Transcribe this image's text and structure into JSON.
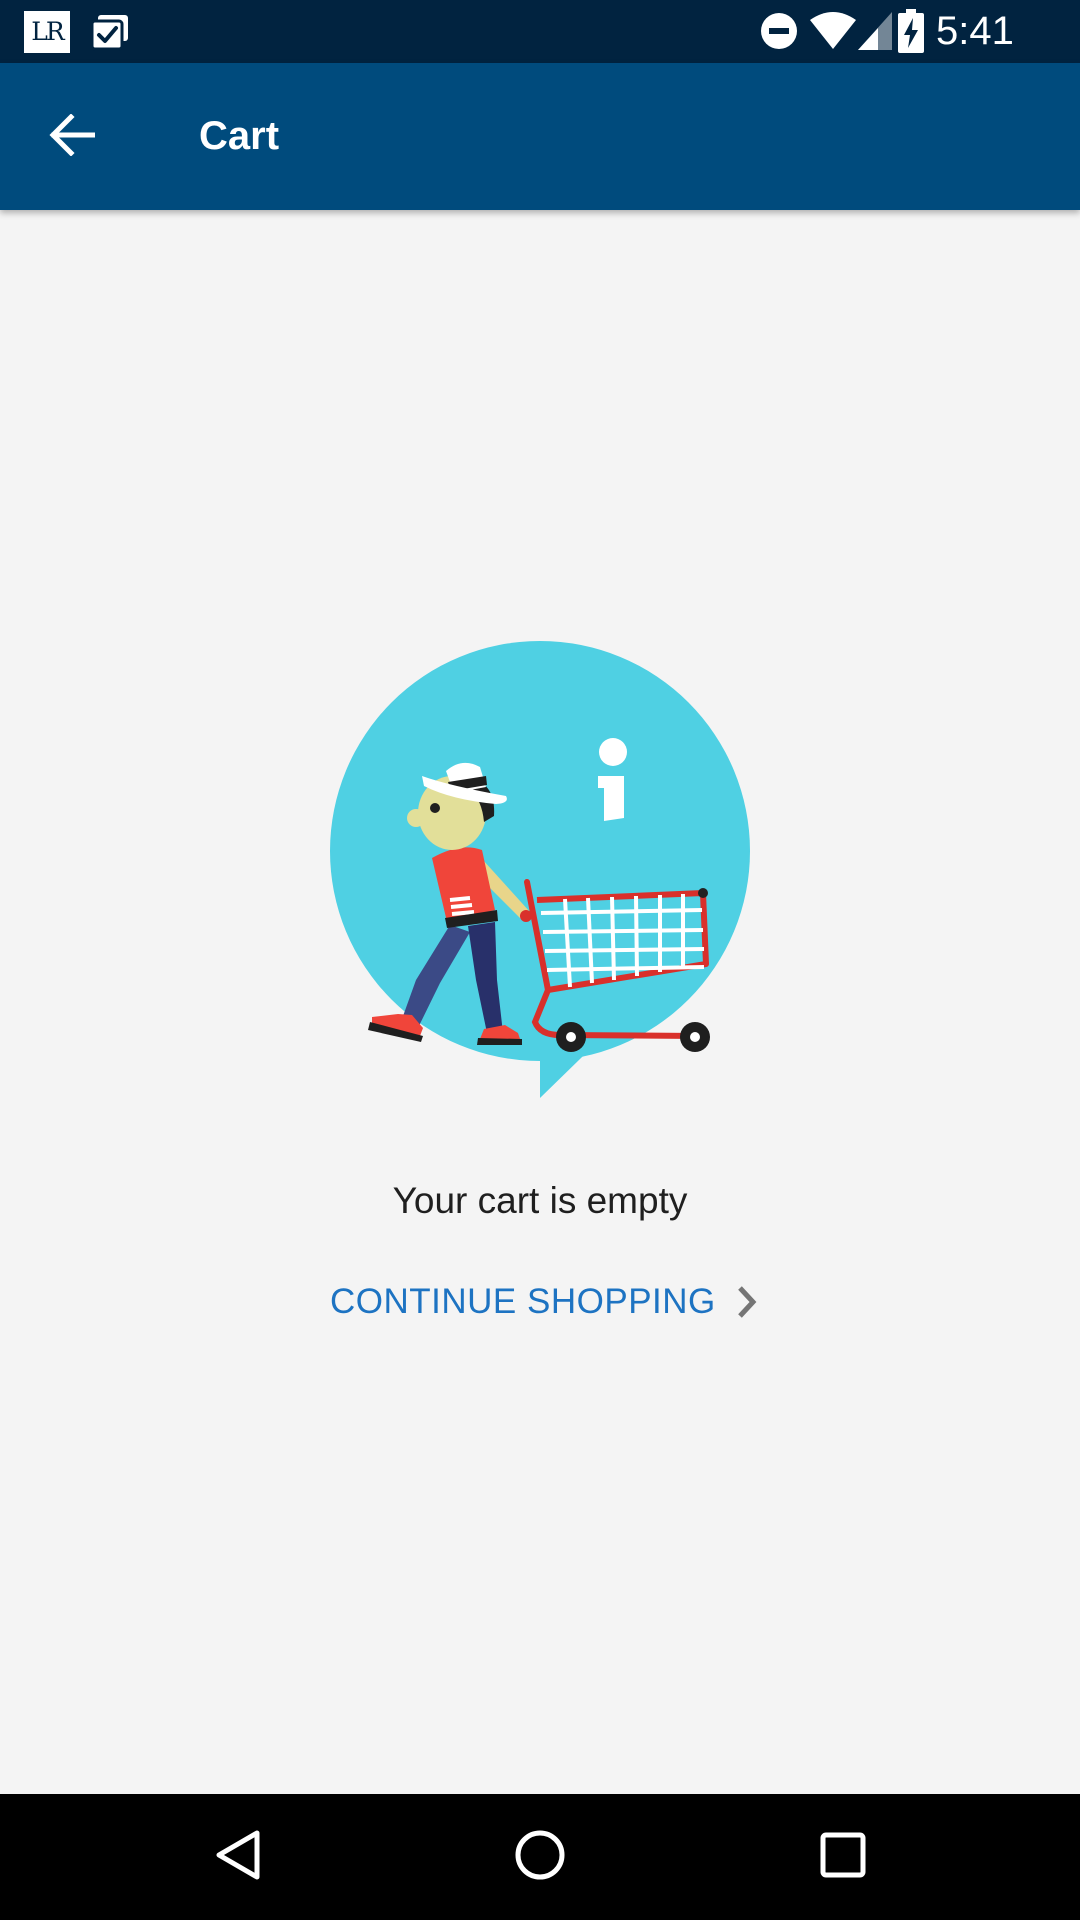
{
  "status_bar": {
    "app_badge": "LR",
    "time": "5:41",
    "icons": [
      "lr-logo-icon",
      "clipboard-check-icon",
      "do-not-disturb-icon",
      "wifi-icon",
      "cell-signal-icon",
      "battery-charging-icon"
    ]
  },
  "app_bar": {
    "title": "Cart",
    "back_icon": "arrow-back-icon"
  },
  "main": {
    "illustration": "empty-cart-illustration",
    "empty_message": "Your cart is empty",
    "continue_label": "CONTINUE SHOPPING",
    "continue_icon": "chevron-right-icon"
  },
  "nav_bar": {
    "icons": [
      "back-triangle-icon",
      "home-circle-icon",
      "recents-square-icon"
    ]
  },
  "colors": {
    "status_bar": "#012340",
    "app_bar": "#004b7d",
    "background": "#f4f4f4",
    "link": "#1d73c2",
    "bubble": "#4fd0e3",
    "accent_red": "#f0453a"
  }
}
